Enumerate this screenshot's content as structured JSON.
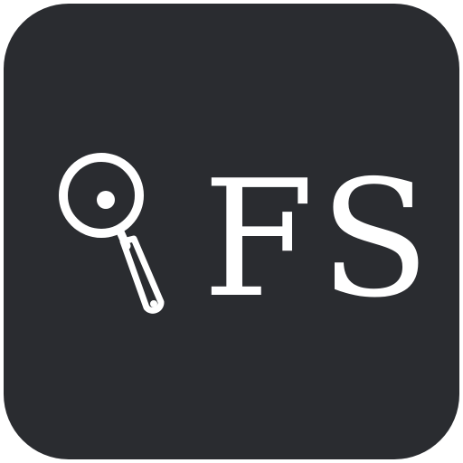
{
  "icon": {
    "logo_text": "FS",
    "symbol": "frying-pan-icon",
    "background_color": "#2a2c30",
    "foreground_color": "#ffffff"
  }
}
